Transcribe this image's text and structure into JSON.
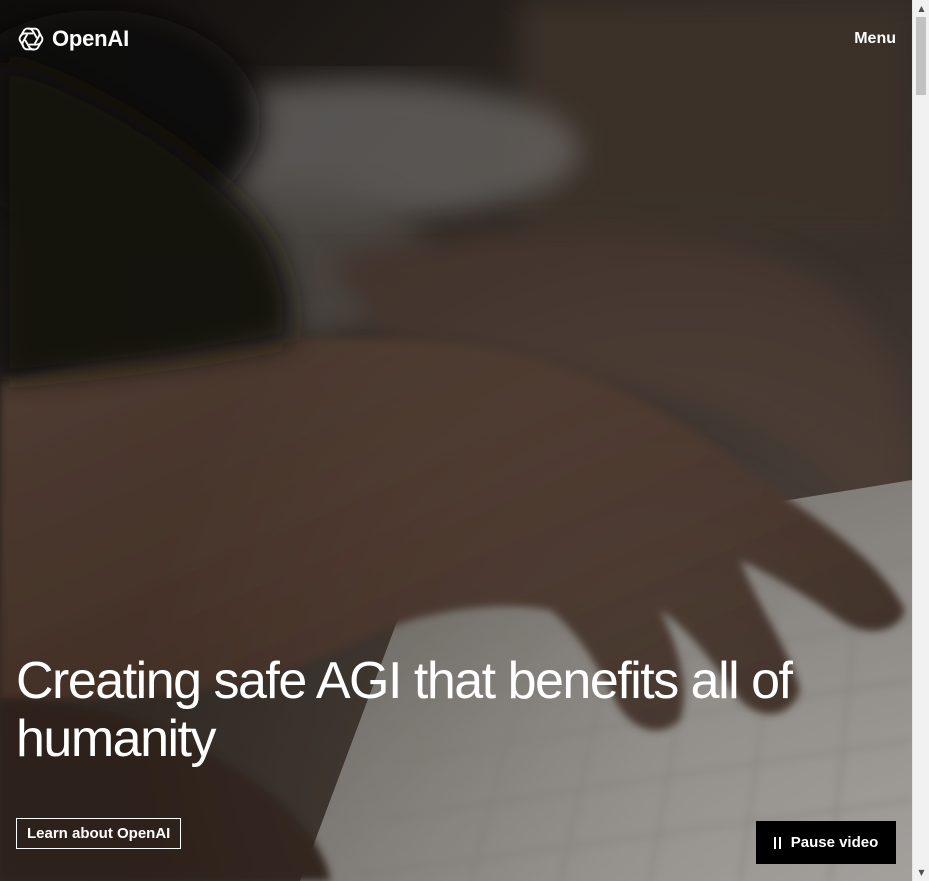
{
  "header": {
    "brand_name": "OpenAI",
    "logo_icon": "openai-logo-icon",
    "menu_label": "Menu"
  },
  "hero": {
    "headline": "Creating safe AGI that benefits all of humanity",
    "cta_label": "Learn about OpenAI",
    "video_control_label": "Pause video",
    "video_control_icon": "pause-icon",
    "background": "video-typing-hands-keyboard"
  },
  "scrollbar": {
    "up_icon": "scroll-up-arrow-icon",
    "down_icon": "scroll-down-arrow-icon"
  }
}
